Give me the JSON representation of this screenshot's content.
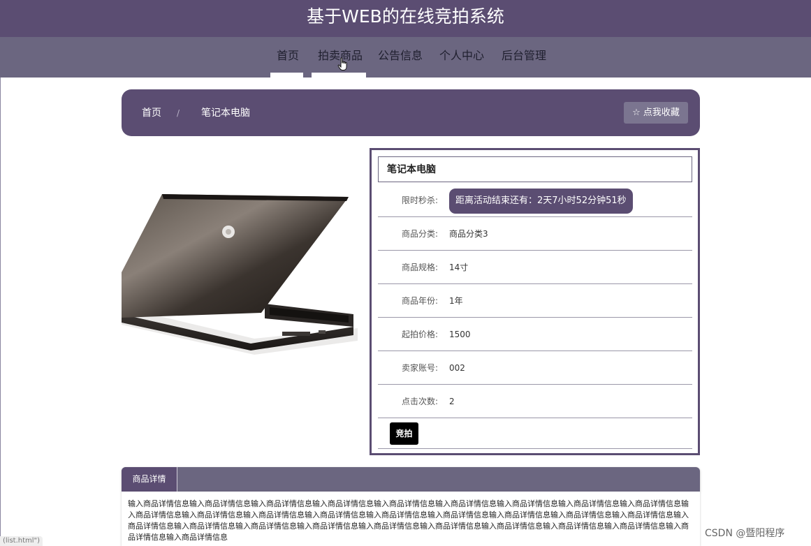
{
  "header": {
    "title": "基于WEB的在线竞拍系统"
  },
  "nav": {
    "items": [
      {
        "label": "首页"
      },
      {
        "label": "拍卖商品"
      },
      {
        "label": "公告信息"
      },
      {
        "label": "个人中心"
      },
      {
        "label": "后台管理"
      }
    ]
  },
  "breadcrumb": {
    "home": "首页",
    "separator": "/",
    "current": "笔记本电脑"
  },
  "favorite": {
    "label": "☆ 点我收藏"
  },
  "product": {
    "title": "笔记本电脑",
    "countdown_label": "限时秒杀:",
    "countdown_text": "距离活动结束还有：2天7小时52分钟51秒",
    "fields": [
      {
        "label": "商品分类:",
        "value": "商品分类3"
      },
      {
        "label": "商品规格:",
        "value": "14寸"
      },
      {
        "label": "商品年份:",
        "value": "1年"
      },
      {
        "label": "起拍价格:",
        "value": "1500"
      },
      {
        "label": "卖家账号:",
        "value": "002"
      },
      {
        "label": "点击次数:",
        "value": "2"
      }
    ],
    "bid_label": "竞拍"
  },
  "details": {
    "tab_label": "商品详情",
    "text": "输入商品详情信息输入商品详情信息输入商品详情信息输入商品详情信息输入商品详情信息输入商品详情信息输入商品详情信息输入商品详情信息输入商品详情信息输入商品详情信息输入商品详情信息输入商品详情信息输入商品详情信息输入商品详情信息输入商品详情信息输入商品详情信息输入商品详情信息输入商品详情信息输入商品详情信息输入商品详情信息输入商品详情信息输入商品详情信息输入商品详情信息输入商品详情信息输入商品详情信息输入商品详情信息输入商品详情信息输入商品详情信息输入商品详情信息"
  },
  "status_bar": {
    "url": "(list.html\")"
  },
  "watermark": {
    "text": "CSDN @暨阳程序"
  },
  "colors": {
    "primary": "#5b4d72",
    "nav_bg": "#6b6680",
    "button_dark": "#000000"
  }
}
